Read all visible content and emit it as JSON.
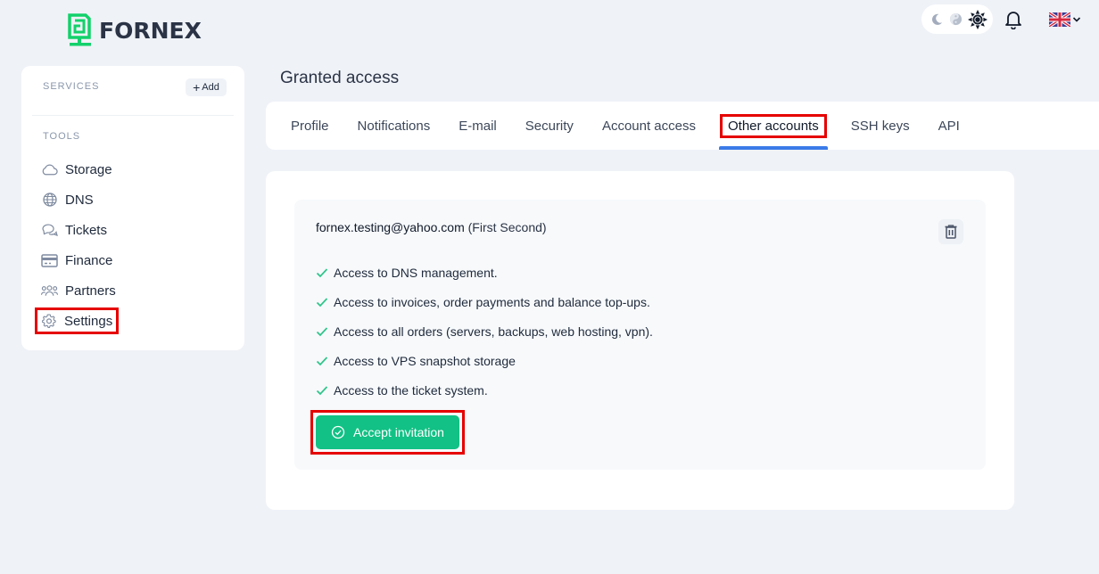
{
  "brand": {
    "name": "FORNEX",
    "accent_color": "#13d16b"
  },
  "topbar": {
    "theme_options": [
      "dark-moon-icon",
      "auto-yin-yang-icon",
      "light-sun-icon"
    ],
    "theme_selected": "light",
    "notifications_icon": "bell-icon",
    "language": "English (UK flag)"
  },
  "sidebar": {
    "services_title": "SERVICES",
    "add_label": "Add",
    "tools_title": "TOOLS",
    "items": [
      {
        "label": "Storage",
        "icon": "cloud-icon"
      },
      {
        "label": "DNS",
        "icon": "globe-icon"
      },
      {
        "label": "Tickets",
        "icon": "chat-bubbles-icon"
      },
      {
        "label": "Finance",
        "icon": "credit-card-icon"
      },
      {
        "label": "Partners",
        "icon": "users-icon"
      },
      {
        "label": "Settings",
        "icon": "gear-icon",
        "highlighted": true
      }
    ]
  },
  "page": {
    "title": "Granted access"
  },
  "tabs": [
    {
      "label": "Profile"
    },
    {
      "label": "Notifications"
    },
    {
      "label": "E-mail"
    },
    {
      "label": "Security"
    },
    {
      "label": "Account access"
    },
    {
      "label": "Other accounts",
      "active": true
    },
    {
      "label": "SSH keys"
    },
    {
      "label": "API"
    }
  ],
  "account": {
    "email": "fornex.testing@yahoo.com",
    "name": "(First Second)",
    "permissions": [
      "Access to DNS management.",
      "Access to invoices, order payments and balance top-ups.",
      "Access to all orders (servers, backups, web hosting, vpn).",
      "Access to VPS snapshot storage",
      "Access to the ticket system."
    ],
    "accept_label": "Accept invitation"
  },
  "colors": {
    "background": "#eff2f7",
    "tab_indicator": "#3b7be8",
    "accept_button": "#12c185",
    "check": "#2fc48a",
    "highlight_box": "#e60000"
  }
}
